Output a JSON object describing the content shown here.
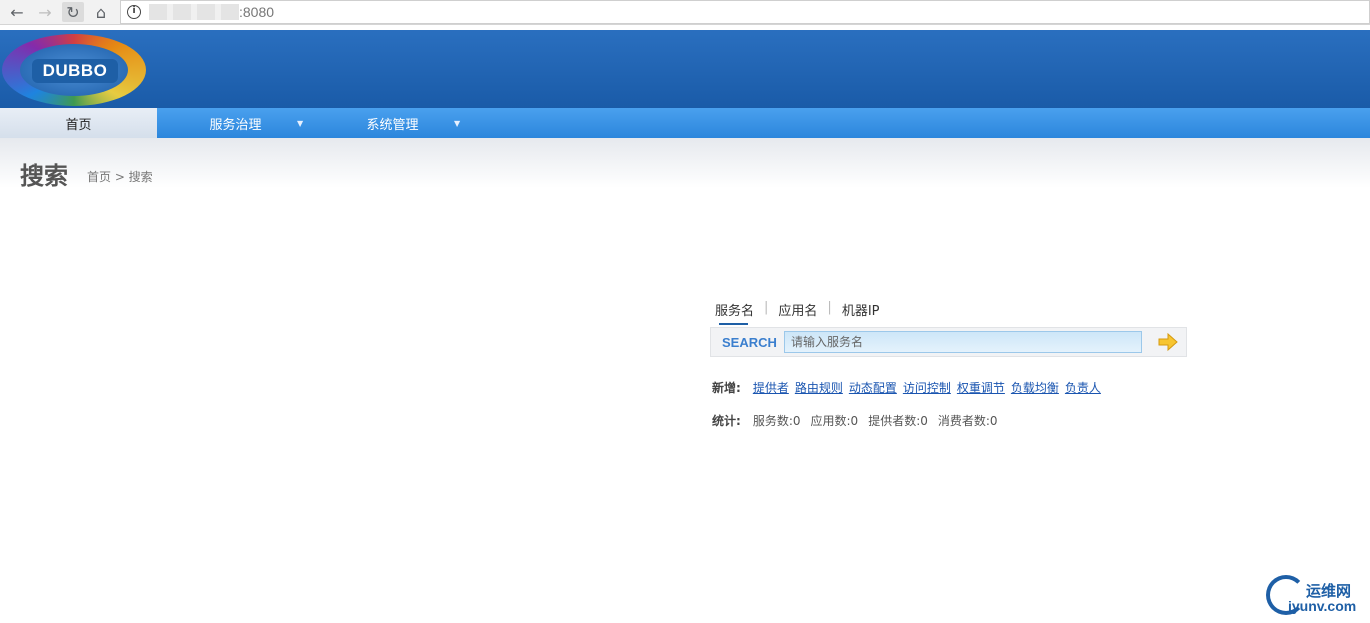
{
  "browser": {
    "url_port": ":8080"
  },
  "header": {
    "logo_text": "DUBBO"
  },
  "nav": {
    "items": [
      {
        "label": "首页"
      },
      {
        "label": "服务治理"
      },
      {
        "label": "系统管理"
      }
    ]
  },
  "page": {
    "title": "搜索",
    "breadcrumb": "首页 > 搜索"
  },
  "search": {
    "tabs": [
      "服务名",
      "应用名",
      "机器IP"
    ],
    "label": "SEARCH",
    "placeholder": "请输入服务名"
  },
  "add": {
    "label": "新增:",
    "links": [
      "提供者",
      "路由规则",
      "动态配置",
      "访问控制",
      "权重调节",
      "负载均衡",
      "负责人"
    ]
  },
  "stats": {
    "label": "统计:",
    "items": [
      "服务数:0",
      "应用数:0",
      "提供者数:0",
      "消费者数:0"
    ]
  },
  "watermark": {
    "cn": "运维网",
    "en": "iyunv.com"
  }
}
